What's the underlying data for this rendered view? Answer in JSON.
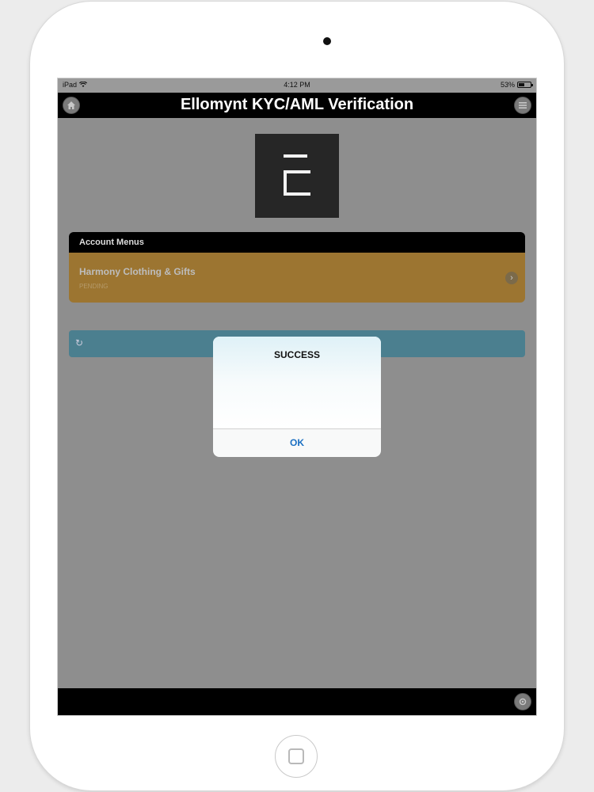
{
  "status": {
    "device": "iPad",
    "time": "4:12 PM",
    "battery": "53%",
    "battery_level": 0.53
  },
  "header": {
    "title": "Ellomynt KYC/AML Verification",
    "home_icon": "home-icon",
    "menu_icon": "menu-icon"
  },
  "logo": {
    "icon": "ellomynt-logo",
    "color": "#262626"
  },
  "account": {
    "header": "Account Menus",
    "item": {
      "name": "Harmony Clothing & Gifts",
      "status": "PENDING",
      "color": "#9c7531"
    }
  },
  "refresh": {
    "icon": "refresh-icon",
    "color": "#4b7f8f"
  },
  "alert": {
    "title": "SUCCESS",
    "ok_label": "OK",
    "ok_color": "#1a6fc2"
  },
  "footer": {
    "icon": "settings-icon"
  }
}
